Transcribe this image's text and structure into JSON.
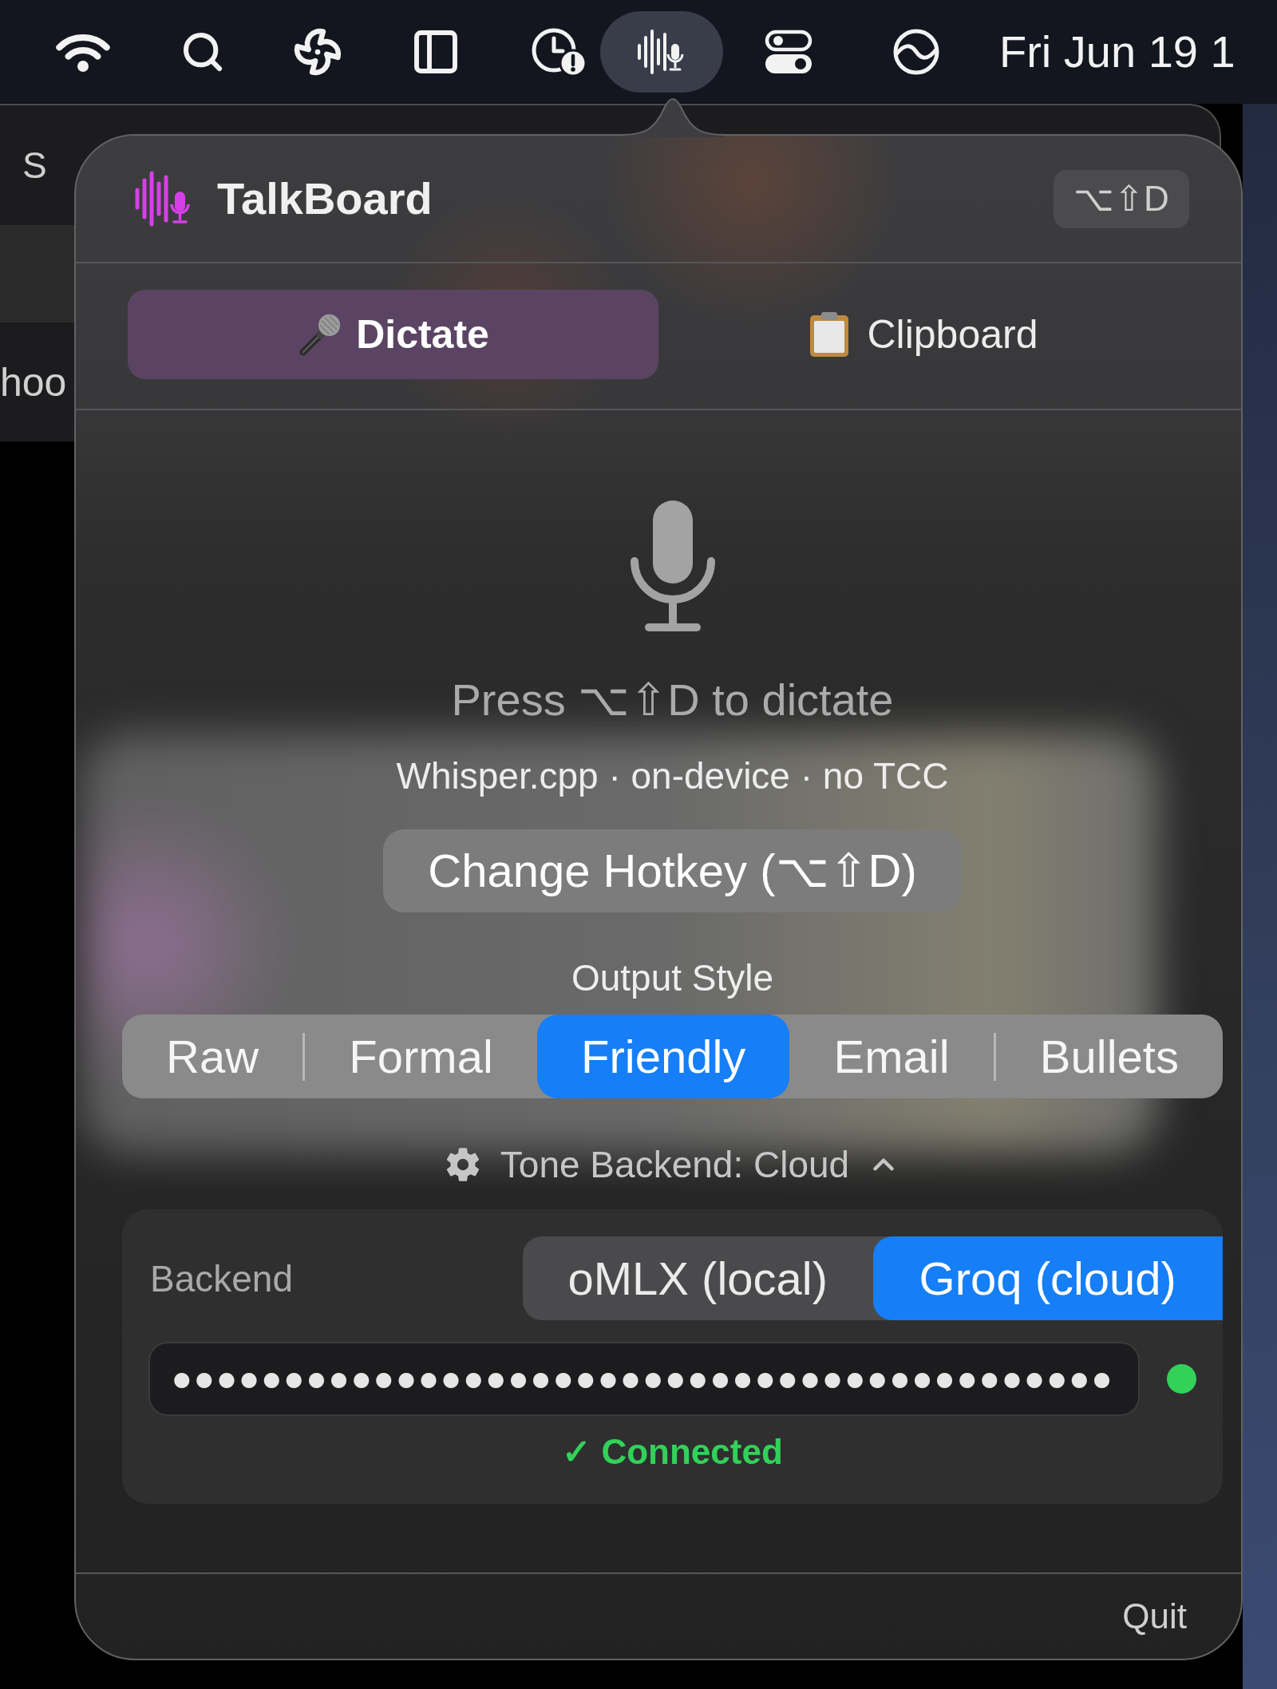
{
  "menu_bar": {
    "items": [
      {
        "selected": false
      },
      {
        "selected": false
      },
      {
        "selected": false
      },
      {
        "selected": false
      },
      {
        "selected": false
      },
      {
        "selected": true
      },
      {
        "selected": false
      },
      {
        "selected": false
      }
    ],
    "clock": "Fri Jun 19 1"
  },
  "background_window": {
    "labels": [
      "S",
      "hoo"
    ]
  },
  "popover": {
    "title": "TalkBoard",
    "shortcut": "⌥⇧D",
    "tabs": [
      {
        "label": "Dictate",
        "selected": true
      },
      {
        "label": "Clipboard",
        "selected": false
      }
    ],
    "prompt": "Press ⌥⇧D to dictate",
    "engine_info": "Whisper.cpp · on-device · no TCC",
    "hotkey_button": "Change Hotkey (⌥⇧D)",
    "output_style": {
      "label": "Output Style",
      "options": [
        {
          "label": "Raw",
          "selected": false
        },
        {
          "label": "Formal",
          "selected": false
        },
        {
          "label": "Friendly",
          "selected": true
        },
        {
          "label": "Email",
          "selected": false
        },
        {
          "label": "Bullets",
          "selected": false
        }
      ]
    },
    "tone_backend": {
      "label": "Tone Backend: Cloud",
      "expanded": true
    },
    "backend_panel": {
      "label": "Backend",
      "options": [
        {
          "label": "oMLX (local)",
          "selected": false
        },
        {
          "label": "Groq (cloud)",
          "selected": true
        }
      ],
      "api_key": {
        "value": "●●●●●●●●●●●●●●●●●●●●●●●●●●●●●●●●●●●●●●●●●●"
      },
      "status": {
        "connected": true,
        "text": "✓ Connected"
      }
    },
    "quit": "Quit"
  }
}
